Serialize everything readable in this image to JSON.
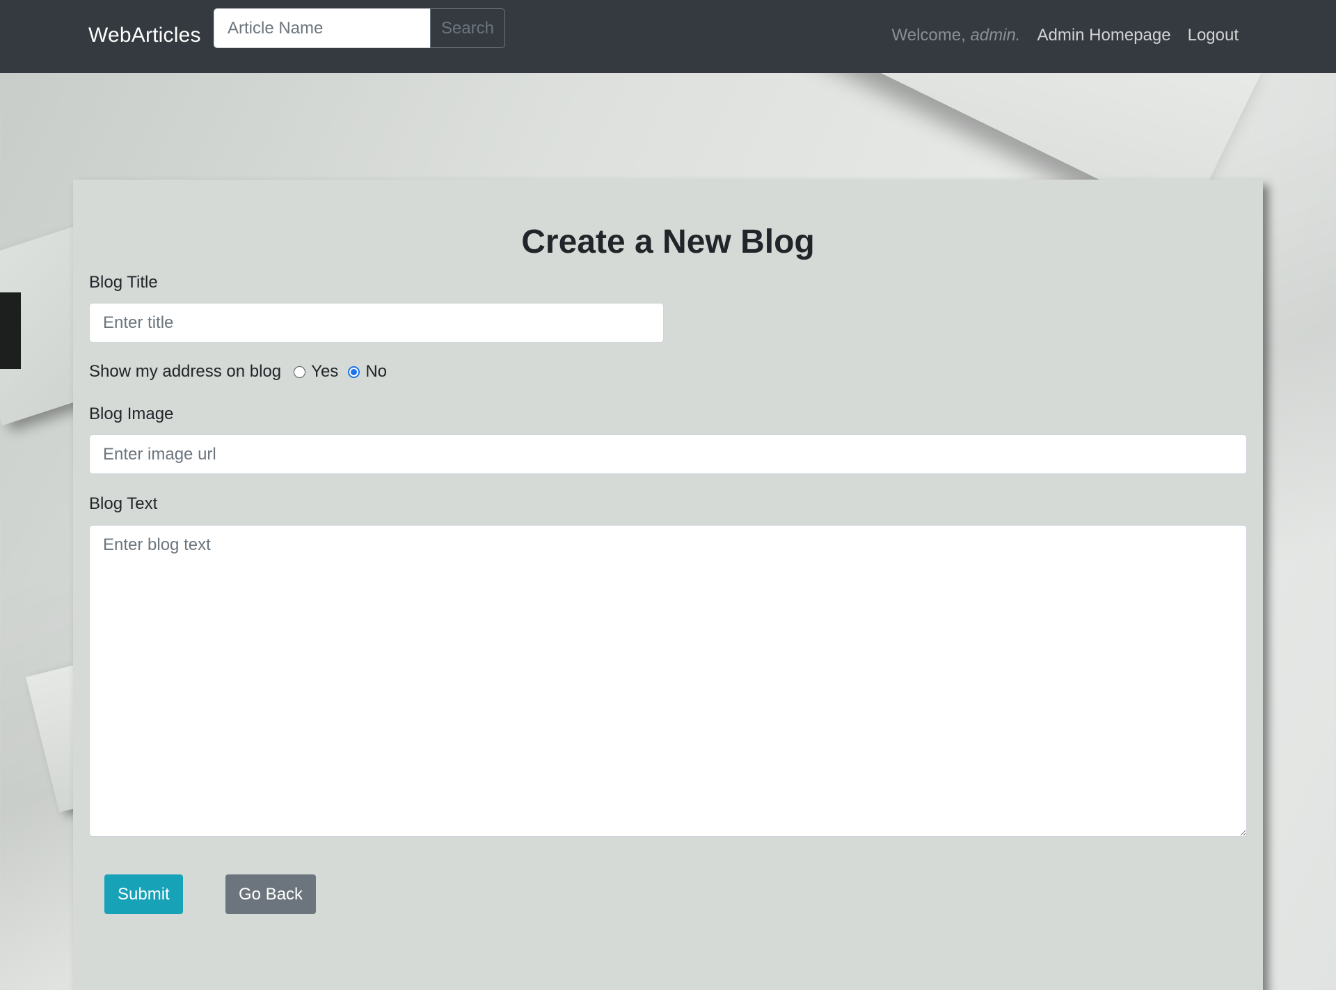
{
  "navbar": {
    "brand": "WebArticles",
    "search_placeholder": "Article Name",
    "search_button": "Search",
    "welcome_prefix": "Welcome, ",
    "welcome_user": "admin.",
    "links": [
      {
        "label": "Admin Homepage"
      },
      {
        "label": "Logout"
      }
    ]
  },
  "form": {
    "title": "Create a New Blog",
    "blog_title_label": "Blog Title",
    "blog_title_placeholder": "Enter title",
    "address_label": "Show my address on blog",
    "address_options": [
      {
        "label": "Yes",
        "checked": false
      },
      {
        "label": "No",
        "checked": true
      }
    ],
    "blog_image_label": "Blog Image",
    "blog_image_placeholder": "Enter image url",
    "blog_text_label": "Blog Text",
    "blog_text_placeholder": "Enter blog text",
    "submit_label": "Submit",
    "back_label": "Go Back"
  },
  "colors": {
    "navbar": "#343a40",
    "submit": "#17a2b8",
    "back": "#6c757d",
    "radio_accent": "#1a73e8"
  }
}
